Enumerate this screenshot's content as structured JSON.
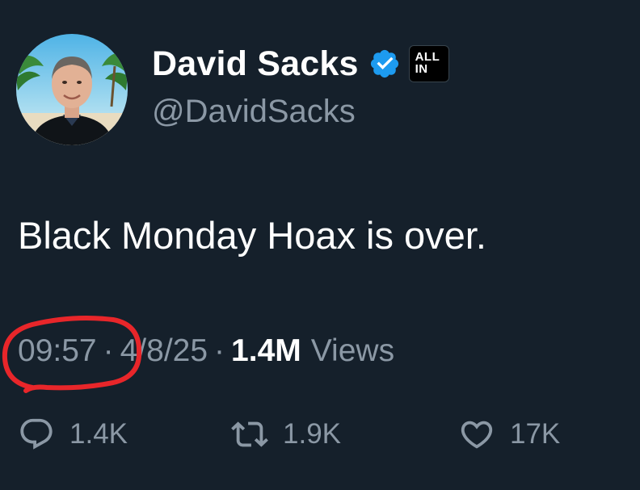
{
  "author": {
    "display_name": "David Sacks",
    "handle": "@DavidSacks",
    "affiliation_badge": "ALL\nIN",
    "verified": true,
    "avatar": "avatar-photo"
  },
  "tweet": {
    "text": "Black Monday Hoax is over."
  },
  "meta": {
    "time": "09:57",
    "separator": "·",
    "date": "4/8/25",
    "views_count": "1.4M",
    "views_label": "Views"
  },
  "actions": {
    "reply_count": "1.4K",
    "retweet_count": "1.9K",
    "like_count": "17K"
  },
  "colors": {
    "background": "#15202b",
    "primary_text": "#ffffff",
    "secondary_text": "#8b98a5",
    "verified_blue": "#1d9bf0",
    "annotation_red": "#e8262a"
  },
  "icons": {
    "verified": "verified-badge-icon",
    "reply": "reply-icon",
    "retweet": "retweet-icon",
    "like": "heart-icon"
  }
}
